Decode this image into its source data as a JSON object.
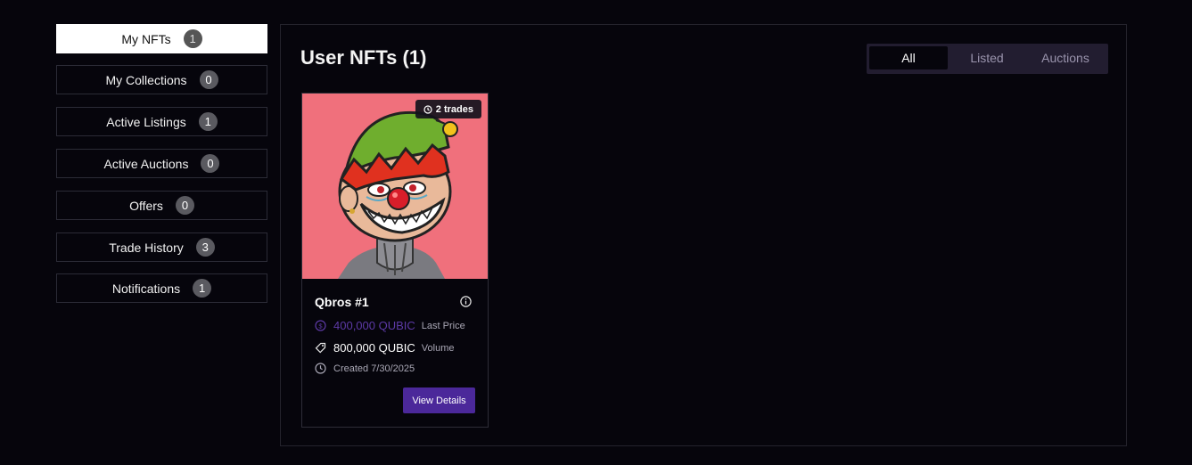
{
  "sidebar": {
    "items": [
      {
        "label": "My NFTs",
        "count": "1"
      },
      {
        "label": "My Collections",
        "count": "0"
      },
      {
        "label": "Active Listings",
        "count": "1"
      },
      {
        "label": "Active Auctions",
        "count": "0"
      },
      {
        "label": "Offers",
        "count": "0"
      },
      {
        "label": "Trade History",
        "count": "3"
      },
      {
        "label": "Notifications",
        "count": "1"
      }
    ]
  },
  "main": {
    "title": "User NFTs (1)",
    "tabs": [
      {
        "label": "All",
        "active": true
      },
      {
        "label": "Listed",
        "active": false
      },
      {
        "label": "Auctions",
        "active": false
      }
    ]
  },
  "nft": {
    "trades_badge": "2 trades",
    "name": "Qbros #1",
    "last_price": "400,000 QUBIC",
    "last_price_label": "Last Price",
    "volume": "800,000 QUBIC",
    "volume_label": "Volume",
    "created": "Created 7/30/2025",
    "view_button": "View Details"
  },
  "colors": {
    "accent": "#4b289a",
    "price_purple": "#5d3aa6",
    "card_bg": "#f0707c",
    "page_bg": "#06050c"
  }
}
